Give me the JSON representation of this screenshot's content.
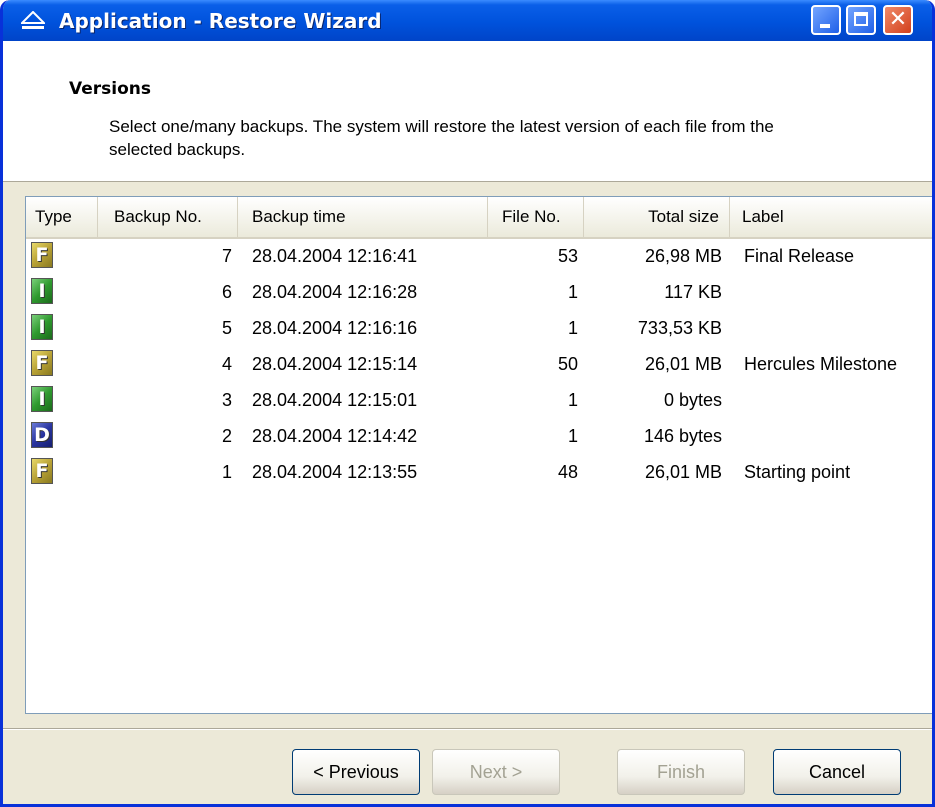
{
  "window": {
    "title": "Application - Restore Wizard"
  },
  "header": {
    "title": "Versions",
    "description": "Select one/many backups. The system will restore the latest version of each file from the selected backups."
  },
  "table": {
    "columns": [
      "Type",
      "Backup No.",
      "Backup time",
      "File No.",
      "Total size",
      "Label"
    ],
    "rows": [
      {
        "type": "F",
        "backup_no": "7",
        "backup_time": "28.04.2004 12:16:41",
        "file_no": "53",
        "total_size": "26,98 MB",
        "label": "Final Release"
      },
      {
        "type": "I",
        "backup_no": "6",
        "backup_time": "28.04.2004 12:16:28",
        "file_no": "1",
        "total_size": "117 KB",
        "label": ""
      },
      {
        "type": "I",
        "backup_no": "5",
        "backup_time": "28.04.2004 12:16:16",
        "file_no": "1",
        "total_size": "733,53 KB",
        "label": ""
      },
      {
        "type": "F",
        "backup_no": "4",
        "backup_time": "28.04.2004 12:15:14",
        "file_no": "50",
        "total_size": "26,01 MB",
        "label": "Hercules Milestone"
      },
      {
        "type": "I",
        "backup_no": "3",
        "backup_time": "28.04.2004 12:15:01",
        "file_no": "1",
        "total_size": "0 bytes",
        "label": ""
      },
      {
        "type": "D",
        "backup_no": "2",
        "backup_time": "28.04.2004 12:14:42",
        "file_no": "1",
        "total_size": "146 bytes",
        "label": ""
      },
      {
        "type": "F",
        "backup_no": "1",
        "backup_time": "28.04.2004 12:13:55",
        "file_no": "48",
        "total_size": "26,01 MB",
        "label": "Starting point"
      }
    ]
  },
  "buttons": {
    "previous": "< Previous",
    "next": "Next >",
    "finish": "Finish",
    "cancel": "Cancel"
  },
  "colors": {
    "titlebar": "#0052dc",
    "type_F": "#b8a236",
    "type_I": "#2f9a2f",
    "type_D": "#2a35a0"
  }
}
